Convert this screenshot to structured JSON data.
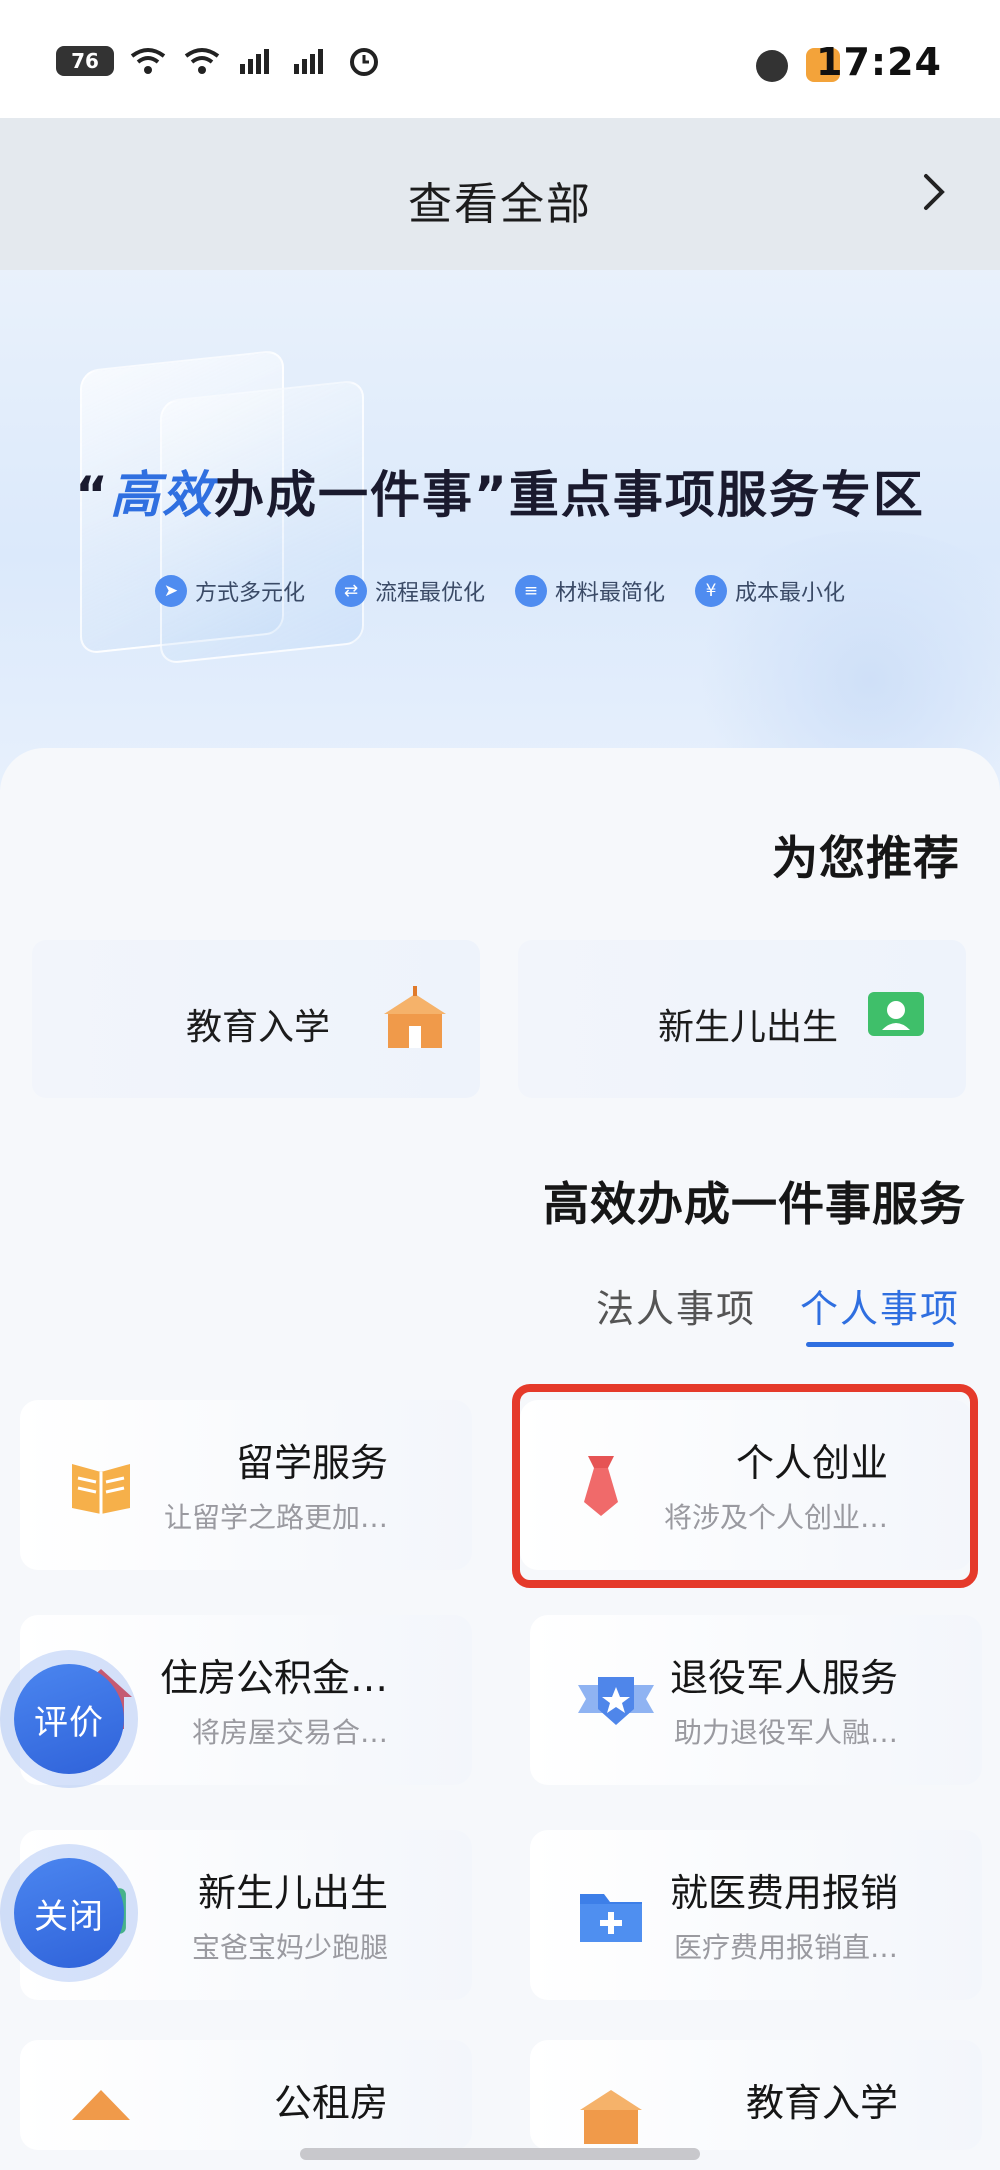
{
  "status_bar": {
    "time": "17:24",
    "battery": "76"
  },
  "header": {
    "title": "查看全部"
  },
  "banner": {
    "title_prefix": "“",
    "title_highlight": "高效",
    "title_rest": "办成一件事”重点事项服务专区",
    "tags": [
      "方式多元化",
      "流程最优化",
      "材料最简化",
      "成本最小化"
    ]
  },
  "recommend": {
    "title": "为您推荐",
    "items": [
      {
        "label": "新生儿出生",
        "icon": "newborn-icon"
      },
      {
        "label": "教育入学",
        "icon": "school-icon"
      }
    ]
  },
  "services_section": {
    "title": "高效办成一件事服务",
    "tabs": [
      {
        "label": "个人事项",
        "active": true
      },
      {
        "label": "法人事项",
        "active": false
      }
    ],
    "items": [
      {
        "title": "个人创业",
        "desc": "将涉及个人创业…",
        "icon": "tie-icon"
      },
      {
        "title": "留学服务",
        "desc": "让留学之路更加…",
        "icon": "book-icon"
      },
      {
        "title": "退役军人服务",
        "desc": "助力退役军人融…",
        "icon": "military-badge-icon"
      },
      {
        "title": "住房公积金…",
        "desc": "将房屋交易合…",
        "icon": "house-fund-icon"
      },
      {
        "title": "就医费用报销",
        "desc": "医疗费用报销直…",
        "icon": "medical-folder-icon"
      },
      {
        "title": "新生儿出生",
        "desc": "宝爸宝妈少跑腿",
        "icon": "newborn-icon"
      },
      {
        "title": "教育入学",
        "desc": "",
        "icon": "school-icon"
      },
      {
        "title": "公租房",
        "desc": "",
        "icon": "rental-house-icon"
      }
    ]
  },
  "floating": {
    "rate_label": "评价",
    "close_label": "关闭"
  },
  "colors": {
    "accent": "#2f6fe0",
    "highlight_border": "#e53a2a"
  }
}
